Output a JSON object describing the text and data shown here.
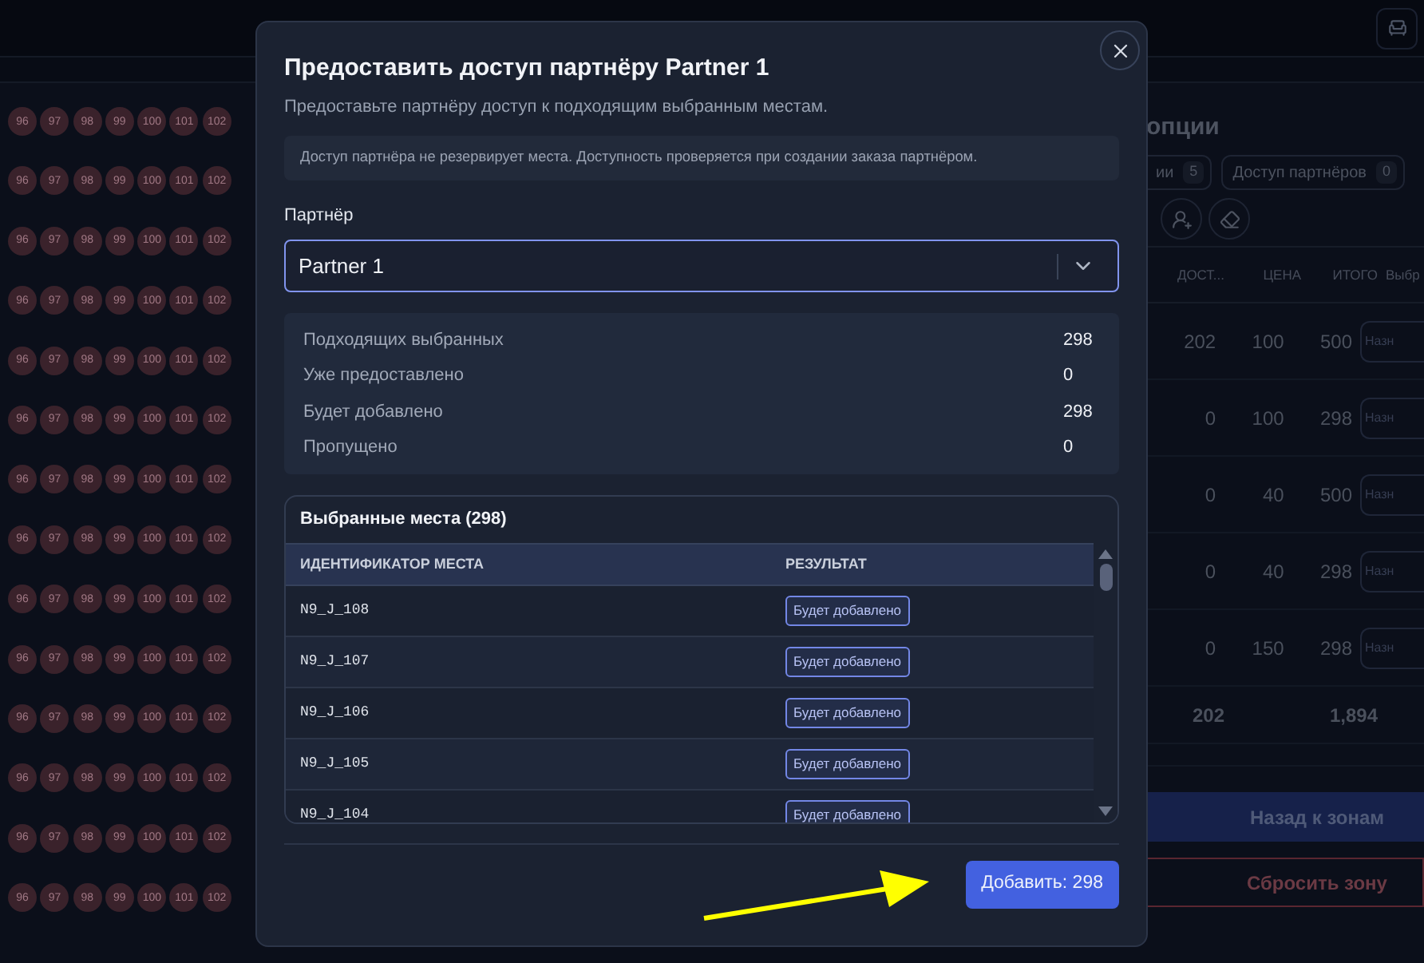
{
  "seat_rows": [
    [
      "96",
      "97",
      "98",
      "99",
      "100",
      "101",
      "102"
    ],
    [
      "96",
      "97",
      "98",
      "99",
      "100",
      "101",
      "102"
    ],
    [
      "96",
      "97",
      "98",
      "99",
      "100",
      "101",
      "102"
    ],
    [
      "96",
      "97",
      "98",
      "99",
      "100",
      "101",
      "102"
    ],
    [
      "96",
      "97",
      "98",
      "99",
      "100",
      "101",
      "102"
    ],
    [
      "96",
      "97",
      "98",
      "99",
      "100",
      "101",
      "102"
    ],
    [
      "96",
      "97",
      "98",
      "99",
      "100",
      "101",
      "102"
    ],
    [
      "96",
      "97",
      "98",
      "99",
      "100",
      "101",
      "102"
    ],
    [
      "96",
      "97",
      "98",
      "99",
      "100",
      "101",
      "102"
    ],
    [
      "96",
      "97",
      "98",
      "99",
      "100",
      "101",
      "102"
    ],
    [
      "96",
      "97",
      "98",
      "99",
      "100",
      "101",
      "102"
    ],
    [
      "96",
      "97",
      "98",
      "99",
      "100",
      "101",
      "102"
    ],
    [
      "96",
      "97",
      "98",
      "99",
      "100",
      "101",
      "102"
    ],
    [
      "96",
      "97",
      "98",
      "99",
      "100",
      "101",
      "102"
    ]
  ],
  "side_panel": {
    "title": "опции",
    "chips": [
      {
        "label": "ии",
        "count": "5"
      },
      {
        "label": "Доступ партнёров",
        "count": "0"
      }
    ],
    "columns": [
      "ДОСТ...",
      "ЦЕНА",
      "ИТОГО",
      "Выбр"
    ],
    "rows": [
      {
        "available": "202",
        "price": "100",
        "total": "500",
        "placeholder": "Назн"
      },
      {
        "available": "0",
        "price": "100",
        "total": "298",
        "placeholder": "Назн"
      },
      {
        "available": "0",
        "price": "40",
        "total": "500",
        "placeholder": "Назн"
      },
      {
        "available": "0",
        "price": "40",
        "total": "298",
        "placeholder": "Назн"
      },
      {
        "available": "0",
        "price": "150",
        "total": "298",
        "placeholder": "Назн"
      }
    ],
    "totals": {
      "available": "202",
      "total": "1,894"
    },
    "buttons": [
      {
        "label": "Назад к зонам",
        "kind": "primary"
      },
      {
        "label": "Сбросить зону",
        "kind": "danger"
      }
    ]
  },
  "dialog": {
    "title": "Предоставить доступ партнёру Partner 1",
    "subtitle": "Предоставьте партнёру доступ к подходящим выбранным местам.",
    "notice": "Доступ партнёра не резервирует места. Доступность проверяется при создании заказа партнёром.",
    "partner_label": "Партнёр",
    "partner_value": "Partner 1",
    "stats": [
      {
        "label": "Подходящих выбранных",
        "value": "298"
      },
      {
        "label": "Уже предоставлено",
        "value": "0"
      },
      {
        "label": "Будет добавлено",
        "value": "298"
      },
      {
        "label": "Пропущено",
        "value": "0"
      }
    ],
    "seats_title": "Выбранные места (298)",
    "columns": [
      "ИДЕНТИФИКАТОР МЕСТА",
      "РЕЗУЛЬТАТ"
    ],
    "rows": [
      {
        "id": "N9_J_108",
        "result": "Будет добавлено"
      },
      {
        "id": "N9_J_107",
        "result": "Будет добавлено"
      },
      {
        "id": "N9_J_106",
        "result": "Будет добавлено"
      },
      {
        "id": "N9_J_105",
        "result": "Будет добавлено"
      },
      {
        "id": "N9_J_104",
        "result": "Будет добавлено"
      }
    ],
    "submit": "Добавить: 298"
  }
}
